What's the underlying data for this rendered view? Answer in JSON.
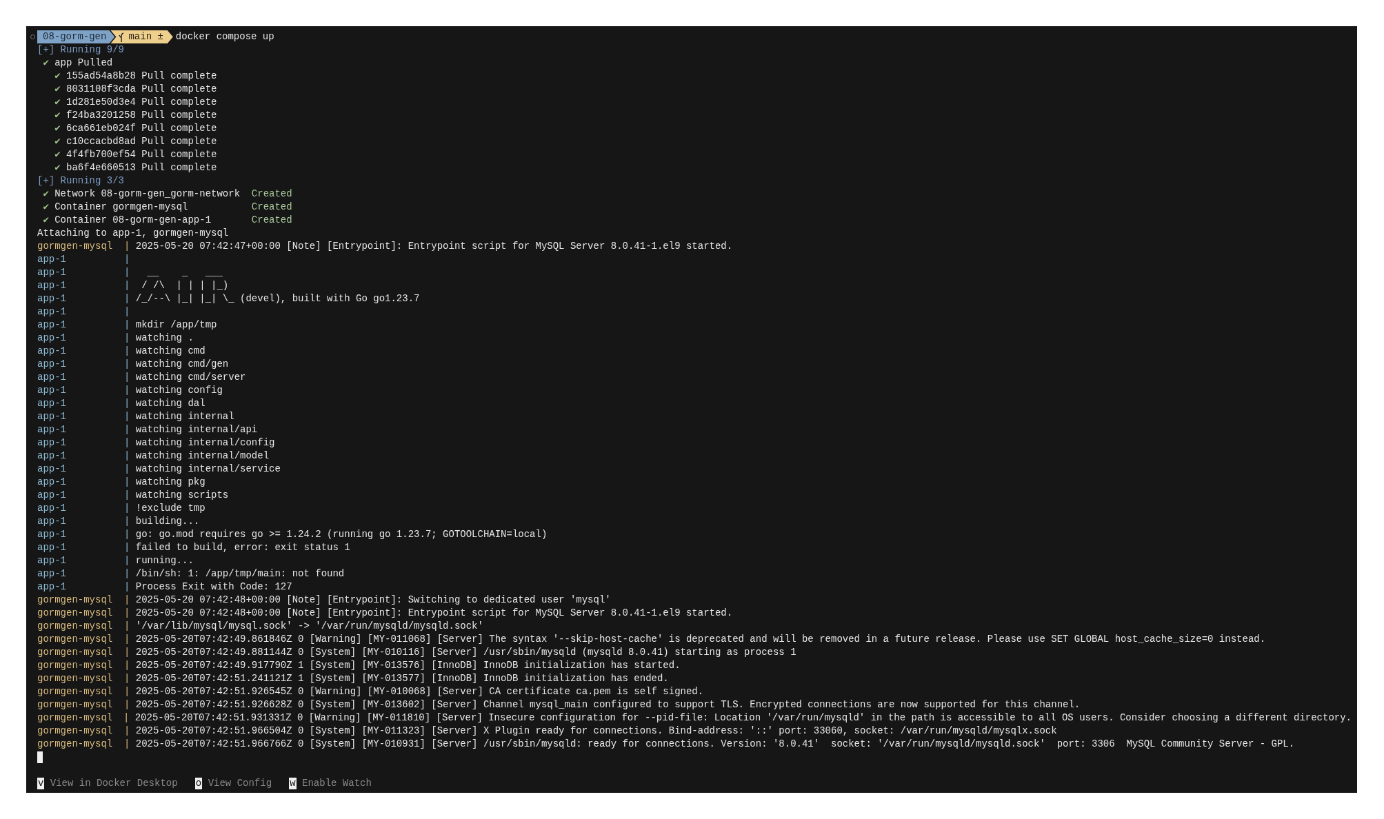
{
  "prompt": {
    "directory": "08-gorm-gen",
    "branch": "main ±",
    "command": "docker compose up"
  },
  "lines": [
    {
      "kind": "progress",
      "text": "[+] Running 9/9"
    },
    {
      "kind": "done",
      "mark": "✔",
      "text": "app Pulled",
      "children": [
        {
          "kind": "done",
          "mark": "✔",
          "text": "155ad54a8b28 Pull complete"
        },
        {
          "kind": "done",
          "mark": "✔",
          "text": "8031108f3cda Pull complete"
        },
        {
          "kind": "done",
          "mark": "✔",
          "text": "1d281e50d3e4 Pull complete"
        },
        {
          "kind": "done",
          "mark": "✔",
          "text": "f24ba3201258 Pull complete"
        },
        {
          "kind": "done",
          "mark": "✔",
          "text": "6ca661eb024f Pull complete"
        },
        {
          "kind": "done",
          "mark": "✔",
          "text": "c10ccacbd8ad Pull complete"
        },
        {
          "kind": "done",
          "mark": "✔",
          "text": "4f4fb700ef54 Pull complete"
        },
        {
          "kind": "done",
          "mark": "✔",
          "text": "ba6f4e660513 Pull complete"
        }
      ]
    },
    {
      "kind": "progress",
      "text": "[+] Running 3/3"
    },
    {
      "kind": "done",
      "mark": "✔",
      "text": "Network 08-gorm-gen_gorm-network",
      "status": "Created"
    },
    {
      "kind": "done",
      "mark": "✔",
      "text": "Container gormgen-mysql",
      "status": "Created"
    },
    {
      "kind": "done",
      "mark": "✔",
      "text": "Container 08-gorm-gen-app-1",
      "status": "Created"
    },
    {
      "kind": "plain",
      "text": "Attaching to app-1, gormgen-mysql"
    },
    {
      "kind": "log",
      "service": "gormgen-mysql",
      "color": "#d9bb7f",
      "separator": "|",
      "message": "2025-05-20 07:42:47+00:00 [Note] [Entrypoint]: Entrypoint script for MySQL Server 8.0.41-1.el9 started."
    },
    {
      "kind": "log",
      "service": "app-1",
      "color": "#8fbcd4",
      "separator": "|"
    },
    {
      "kind": "log",
      "service": "app-1",
      "color": "#8fbcd4",
      "separator": "|",
      "message": "  __    _   ___"
    },
    {
      "kind": "log",
      "service": "app-1",
      "color": "#8fbcd4",
      "separator": "|",
      "message": " / /\\  | | | |_)"
    },
    {
      "kind": "log",
      "service": "app-1",
      "color": "#8fbcd4",
      "separator": "|",
      "message": "/_/--\\ |_| |_| \\_ (devel), built with Go go1.23.7"
    },
    {
      "kind": "log",
      "service": "app-1",
      "color": "#8fbcd4",
      "separator": "|"
    },
    {
      "kind": "log",
      "service": "app-1",
      "color": "#8fbcd4",
      "separator": "|",
      "message": "mkdir /app/tmp"
    },
    {
      "kind": "log",
      "service": "app-1",
      "color": "#8fbcd4",
      "separator": "|",
      "message": "watching ."
    },
    {
      "kind": "log",
      "service": "app-1",
      "color": "#8fbcd4",
      "separator": "|",
      "message": "watching cmd"
    },
    {
      "kind": "log",
      "service": "app-1",
      "color": "#8fbcd4",
      "separator": "|",
      "message": "watching cmd/gen"
    },
    {
      "kind": "log",
      "service": "app-1",
      "color": "#8fbcd4",
      "separator": "|",
      "message": "watching cmd/server"
    },
    {
      "kind": "log",
      "service": "app-1",
      "color": "#8fbcd4",
      "separator": "|",
      "message": "watching config"
    },
    {
      "kind": "log",
      "service": "app-1",
      "color": "#8fbcd4",
      "separator": "|",
      "message": "watching dal"
    },
    {
      "kind": "log",
      "service": "app-1",
      "color": "#8fbcd4",
      "separator": "|",
      "message": "watching internal"
    },
    {
      "kind": "log",
      "service": "app-1",
      "color": "#8fbcd4",
      "separator": "|",
      "message": "watching internal/api"
    },
    {
      "kind": "log",
      "service": "app-1",
      "color": "#8fbcd4",
      "separator": "|",
      "message": "watching internal/config"
    },
    {
      "kind": "log",
      "service": "app-1",
      "color": "#8fbcd4",
      "separator": "|",
      "message": "watching internal/model"
    },
    {
      "kind": "log",
      "service": "app-1",
      "color": "#8fbcd4",
      "separator": "|",
      "message": "watching internal/service"
    },
    {
      "kind": "log",
      "service": "app-1",
      "color": "#8fbcd4",
      "separator": "|",
      "message": "watching pkg"
    },
    {
      "kind": "log",
      "service": "app-1",
      "color": "#8fbcd4",
      "separator": "|",
      "message": "watching scripts"
    },
    {
      "kind": "log",
      "service": "app-1",
      "color": "#8fbcd4",
      "separator": "|",
      "message": "!exclude tmp"
    },
    {
      "kind": "log",
      "service": "app-1",
      "color": "#8fbcd4",
      "separator": "|",
      "message": "building..."
    },
    {
      "kind": "log",
      "service": "app-1",
      "color": "#8fbcd4",
      "separator": "|",
      "message": "go: go.mod requires go >= 1.24.2 (running go 1.23.7; GOTOOLCHAIN=local)"
    },
    {
      "kind": "log",
      "service": "app-1",
      "color": "#8fbcd4",
      "separator": "|",
      "message": "failed to build, error: exit status 1"
    },
    {
      "kind": "log",
      "service": "app-1",
      "color": "#8fbcd4",
      "separator": "|",
      "message": "running..."
    },
    {
      "kind": "log",
      "service": "app-1",
      "color": "#8fbcd4",
      "separator": "|",
      "message": "/bin/sh: 1: /app/tmp/main: not found"
    },
    {
      "kind": "log",
      "service": "app-1",
      "color": "#8fbcd4",
      "separator": "|",
      "message": "Process Exit with Code: 127"
    },
    {
      "kind": "log",
      "service": "gormgen-mysql",
      "color": "#d9bb7f",
      "separator": "|",
      "message": "2025-05-20 07:42:48+00:00 [Note] [Entrypoint]: Switching to dedicated user 'mysql'"
    },
    {
      "kind": "log",
      "service": "gormgen-mysql",
      "color": "#d9bb7f",
      "separator": "|",
      "message": "2025-05-20 07:42:48+00:00 [Note] [Entrypoint]: Entrypoint script for MySQL Server 8.0.41-1.el9 started."
    },
    {
      "kind": "log",
      "service": "gormgen-mysql",
      "color": "#d9bb7f",
      "separator": "|",
      "message": "'/var/lib/mysql/mysql.sock' -> '/var/run/mysqld/mysqld.sock'"
    },
    {
      "kind": "log",
      "service": "gormgen-mysql",
      "color": "#d9bb7f",
      "separator": "|",
      "message": "2025-05-20T07:42:49.861846Z 0 [Warning] [MY-011068] [Server] The syntax '--skip-host-cache' is deprecated and will be removed in a future release. Please use SET GLOBAL host_cache_size=0 instead."
    },
    {
      "kind": "log",
      "service": "gormgen-mysql",
      "color": "#d9bb7f",
      "separator": "|",
      "message": "2025-05-20T07:42:49.881144Z 0 [System] [MY-010116] [Server] /usr/sbin/mysqld (mysqld 8.0.41) starting as process 1"
    },
    {
      "kind": "log",
      "service": "gormgen-mysql",
      "color": "#d9bb7f",
      "separator": "|",
      "message": "2025-05-20T07:42:49.917790Z 1 [System] [MY-013576] [InnoDB] InnoDB initialization has started."
    },
    {
      "kind": "log",
      "service": "gormgen-mysql",
      "color": "#d9bb7f",
      "separator": "|",
      "message": "2025-05-20T07:42:51.241121Z 1 [System] [MY-013577] [InnoDB] InnoDB initialization has ended."
    },
    {
      "kind": "log",
      "service": "gormgen-mysql",
      "color": "#d9bb7f",
      "separator": "|",
      "message": "2025-05-20T07:42:51.926545Z 0 [Warning] [MY-010068] [Server] CA certificate ca.pem is self signed."
    },
    {
      "kind": "log",
      "service": "gormgen-mysql",
      "color": "#d9bb7f",
      "separator": "|",
      "message": "2025-05-20T07:42:51.926628Z 0 [System] [MY-013602] [Server] Channel mysql_main configured to support TLS. Encrypted connections are now supported for this channel."
    },
    {
      "kind": "log",
      "service": "gormgen-mysql",
      "color": "#d9bb7f",
      "separator": "|",
      "message": "2025-05-20T07:42:51.931331Z 0 [Warning] [MY-011810] [Server] Insecure configuration for --pid-file: Location '/var/run/mysqld' in the path is accessible to all OS users. Consider choosing a different directory."
    },
    {
      "kind": "log",
      "service": "gormgen-mysql",
      "color": "#d9bb7f",
      "separator": "|",
      "message": "2025-05-20T07:42:51.966504Z 0 [System] [MY-011323] [Server] X Plugin ready for connections. Bind-address: '::' port: 33060, socket: /var/run/mysqld/mysqlx.sock"
    },
    {
      "kind": "log",
      "service": "gormgen-mysql",
      "color": "#d9bb7f",
      "separator": "|",
      "message": "2025-05-20T07:42:51.966766Z 0 [System] [MY-010931] [Server] /usr/sbin/mysqld: ready for connections. Version: '8.0.41'  socket: '/var/run/mysqld/mysqld.sock'  port: 3306  MySQL Community Server - GPL."
    }
  ],
  "shortcuts": [
    {
      "key": "v",
      "label": "View in Docker Desktop"
    },
    {
      "key": "o",
      "label": "View Config"
    },
    {
      "key": "w",
      "label": "Enable Watch"
    }
  ]
}
